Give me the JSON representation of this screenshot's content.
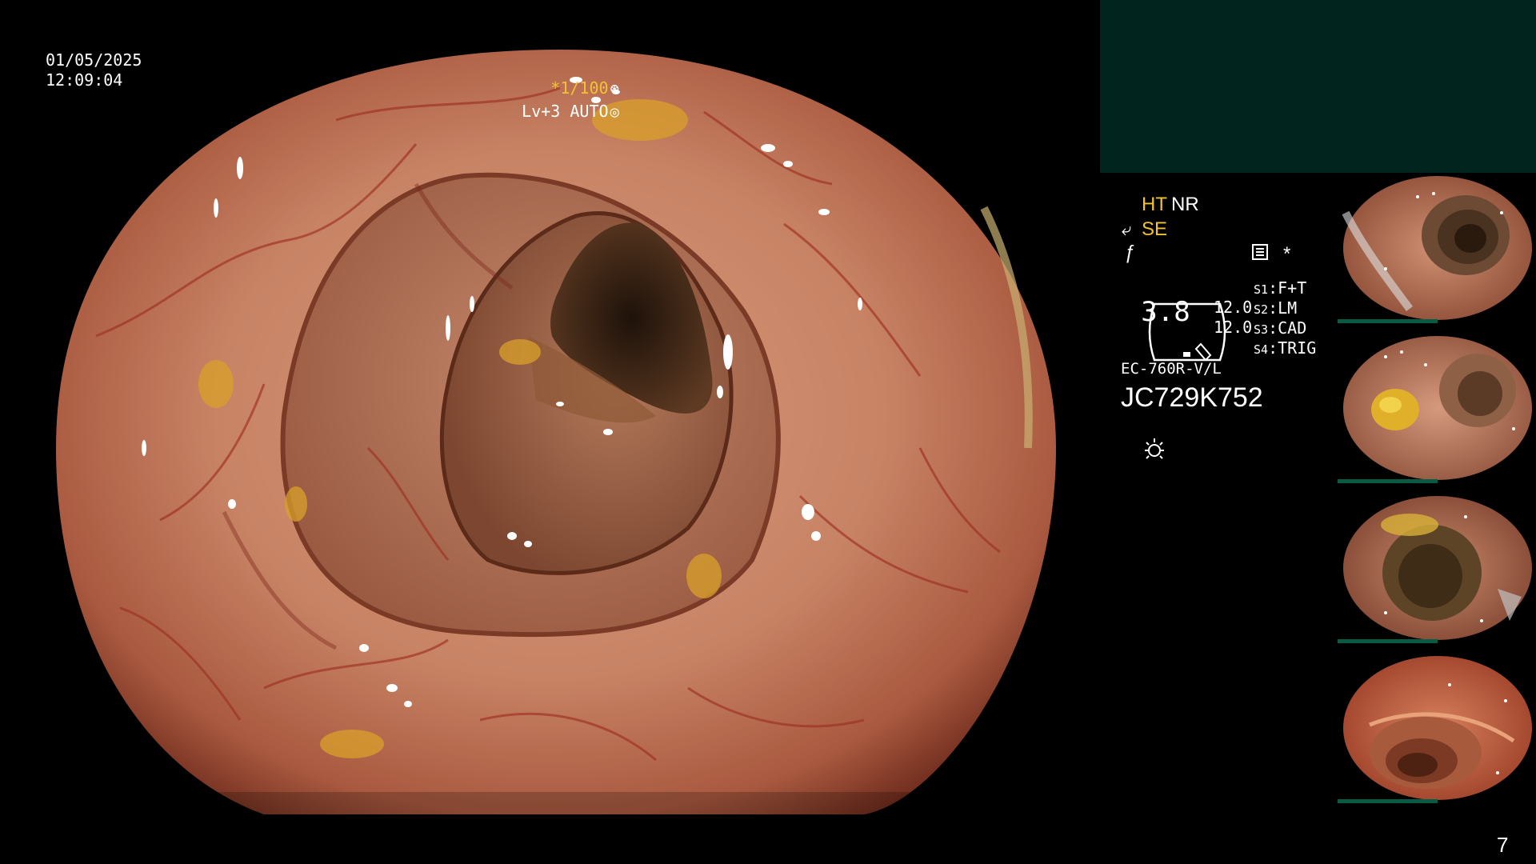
{
  "overlay": {
    "date": "01/05/2025",
    "time": "12:09:04",
    "shutter": "*1/100",
    "shutter_icon": "aperture-icon",
    "iris": "Lv+3 AUTO",
    "iris_icon": "iris-auto-icon"
  },
  "panel": {
    "ht": "HT",
    "nr": "NR",
    "se": "SE",
    "se_icon": "structure-enhance-icon",
    "f_icon": "freeze-icon",
    "menu_icon": "document-icon",
    "star": "*",
    "gauge_value": "3.8",
    "value_1": "12.0",
    "value_2": "12.0",
    "switches": [
      {
        "key": "S1",
        "value": "F+T"
      },
      {
        "key": "S2",
        "value": "LM"
      },
      {
        "key": "S3",
        "value": "CAD"
      },
      {
        "key": "S4",
        "value": "TRIG"
      }
    ],
    "scope_model": "EC-760R-V/L",
    "serial": "JC729K752",
    "light_icon": "light-source-icon"
  },
  "thumbnails": [
    {
      "variant": "deep"
    },
    {
      "variant": "polyp"
    },
    {
      "variant": "debris"
    },
    {
      "variant": "red"
    }
  ],
  "page_number": "7",
  "colors": {
    "accent_yellow": "#f2c234",
    "capture_box": "#02241f",
    "mucosa": "#c67f62",
    "thumb_bar": "#0a5a44"
  }
}
